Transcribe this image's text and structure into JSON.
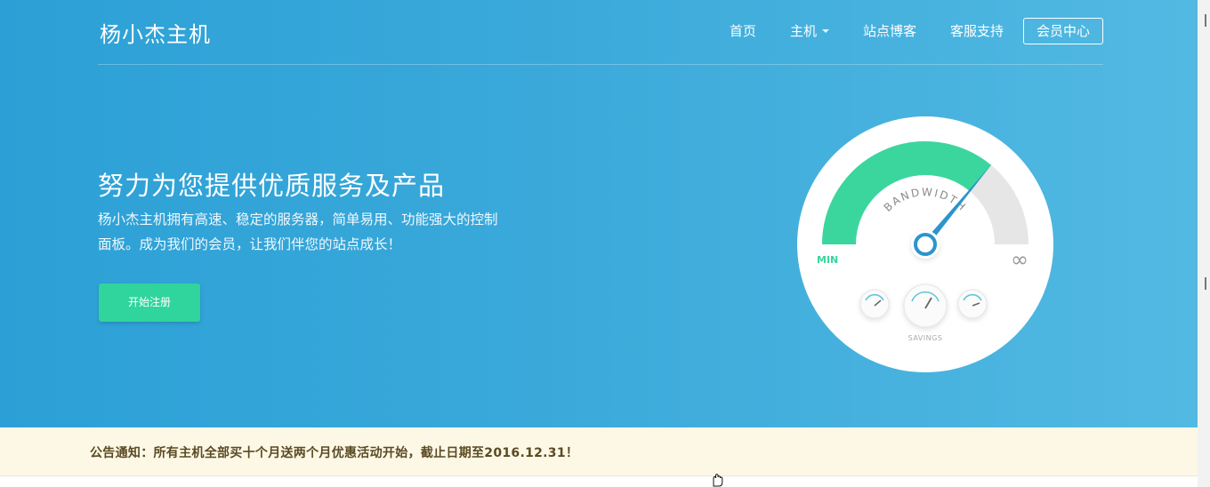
{
  "brand": {
    "name": "杨小杰主机"
  },
  "nav": {
    "items": [
      {
        "label": "首页",
        "has_caret": false
      },
      {
        "label": "主机",
        "has_caret": true
      },
      {
        "label": "站点博客",
        "has_caret": false
      },
      {
        "label": "客服支持",
        "has_caret": false
      }
    ],
    "member_center": "会员中心"
  },
  "hero": {
    "headline": "努力为您提供优质服务及产品",
    "description": "杨小杰主机拥有高速、稳定的服务器，简单易用、功能强大的控制面板。成为我们的会员，让我们伴您的站点成长！",
    "cta_label": "开始注册"
  },
  "gauge": {
    "title": "BANDWIDTH",
    "min_label": "MIN",
    "max_label": "∞",
    "savings_label": "SAVINGS",
    "level_percent": 72,
    "colors": {
      "fill": "#3ad69e",
      "track": "#e6e6e6",
      "needle": "#2b95cc"
    }
  },
  "notice": {
    "text": "公告通知：所有主机全部买十个月送两个月优惠活动开始，截止日期至2016.12.31！"
  },
  "colors": {
    "hero_start": "#2ca0d6",
    "hero_end": "#52b9e2",
    "cta": "#2fd59c",
    "notice_bg": "#fdf8e6",
    "notice_text": "#5a4a22"
  },
  "icons": {
    "cursor": "hand-pointer-icon",
    "nav_caret": "caret-down-icon",
    "infinity": "infinity-icon"
  }
}
